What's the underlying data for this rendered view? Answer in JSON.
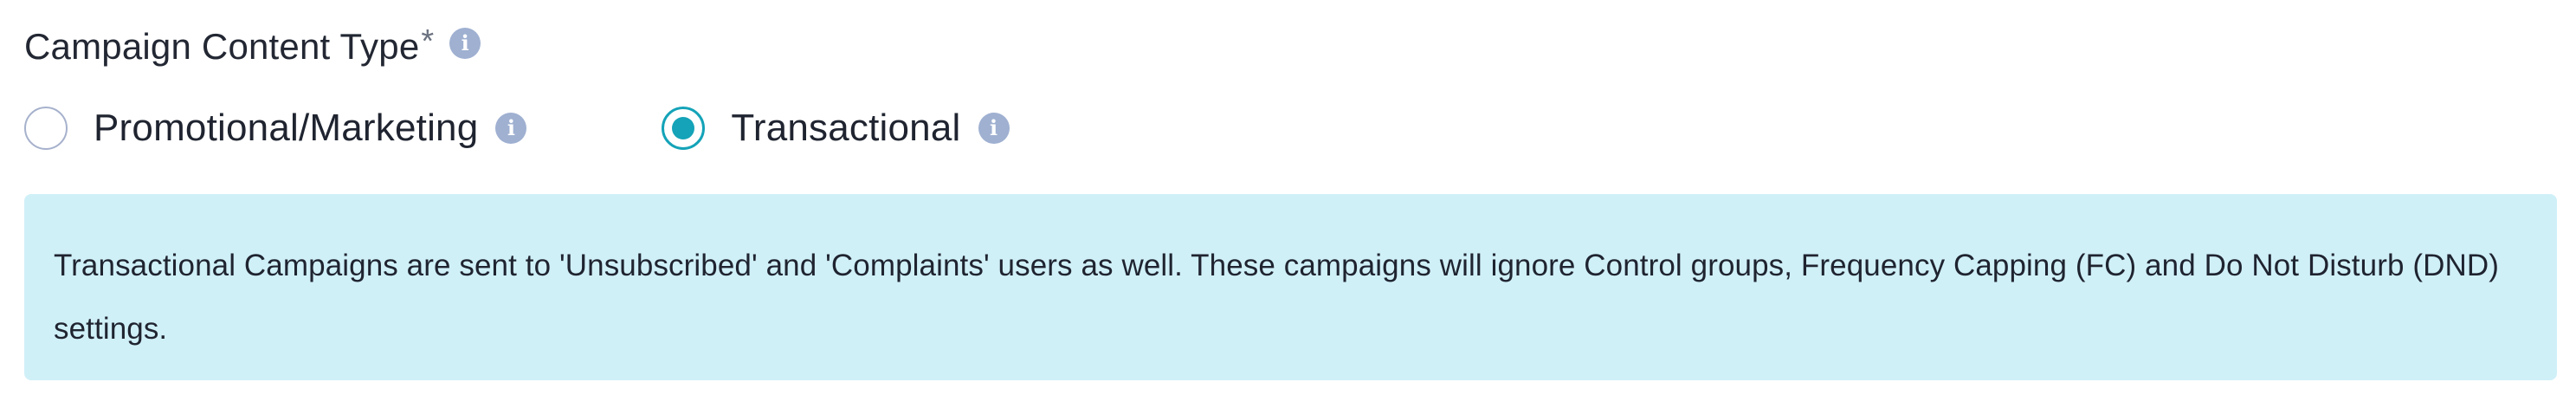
{
  "field": {
    "label": "Campaign Content Type",
    "required_mark": "*",
    "info_icon": "info-icon"
  },
  "radio_options": [
    {
      "label": "Promotional/Marketing",
      "selected": false,
      "info_icon": "info-icon"
    },
    {
      "label": "Transactional",
      "selected": true,
      "info_icon": "info-icon"
    }
  ],
  "notice": {
    "text": "Transactional Campaigns are sent to 'Unsubscribed' and 'Complaints' users as well. These campaigns will ignore Control groups, Frequency Capping (FC) and Do Not Disturb (DND) settings."
  },
  "colors": {
    "accent": "#14a3b8",
    "info_icon": "#9fb0d1",
    "notice_background": "#d0f0f8",
    "radio_border": "#a6b1cc"
  }
}
